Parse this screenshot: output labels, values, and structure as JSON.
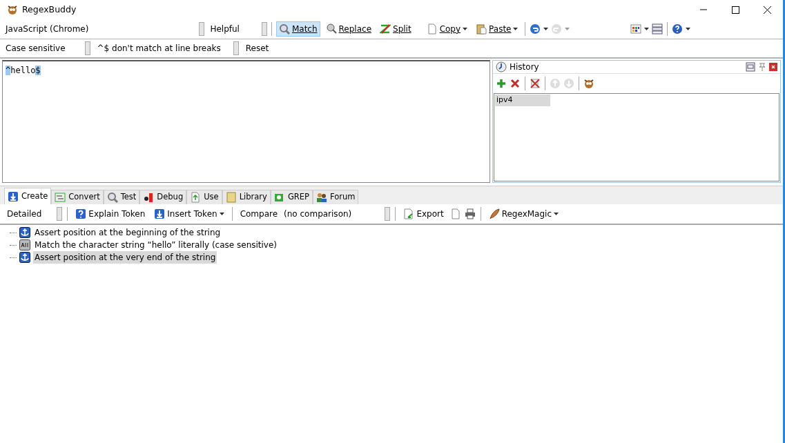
{
  "window": {
    "title": "RegexBuddy"
  },
  "toolbar": {
    "flavor": "JavaScript (Chrome)",
    "mode": "Helpful",
    "buttons": [
      {
        "label": "Match",
        "selected": true,
        "caret": false
      },
      {
        "label": "Replace",
        "selected": false,
        "caret": false
      },
      {
        "label": "Split",
        "selected": false,
        "caret": false
      },
      {
        "label": "Copy",
        "selected": false,
        "caret": true
      },
      {
        "label": "Paste",
        "selected": false,
        "caret": true
      }
    ]
  },
  "options": [
    "Case sensitive",
    "^$ don't match at line breaks",
    "Reset"
  ],
  "regex": [
    {
      "text": "^",
      "highlighted": true
    },
    {
      "text": "hello",
      "highlighted": false
    },
    {
      "text": "$",
      "highlighted": true
    }
  ],
  "history": {
    "title": "History",
    "items": [
      {
        "label": "ipv4",
        "selected": true
      }
    ]
  },
  "tabs": [
    {
      "label": "Create",
      "selected": true
    },
    {
      "label": "Convert",
      "selected": false
    },
    {
      "label": "Test",
      "selected": false
    },
    {
      "label": "Debug",
      "selected": false
    },
    {
      "label": "Use",
      "selected": false
    },
    {
      "label": "Library",
      "selected": false
    },
    {
      "label": "GREP",
      "selected": false
    },
    {
      "label": "Forum",
      "selected": false
    }
  ],
  "create_toolbar": {
    "detail": "Detailed",
    "explain": "Explain Token",
    "insert": "Insert Token",
    "compare": "Compare",
    "comparison": "(no comparison)",
    "export": "Export",
    "magic": "RegexMagic"
  },
  "tree": [
    {
      "kind": "anchor",
      "label": "Assert position at the beginning of the string",
      "selected": false
    },
    {
      "kind": "literal",
      "label": "Match the character string “hello” literally (case sensitive)",
      "selected": false
    },
    {
      "kind": "anchor",
      "label": "Assert position at the very end of the string",
      "selected": true
    }
  ]
}
